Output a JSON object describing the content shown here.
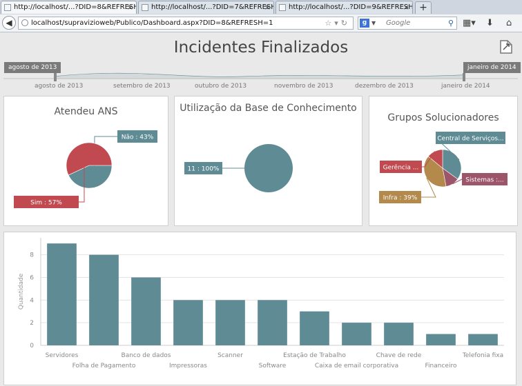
{
  "browser": {
    "tabs": [
      {
        "label": "http://localhost/...?DID=8&REFRESH=1",
        "active": true,
        "close": "×"
      },
      {
        "label": "http://localhost/...?DID=7&REFRESH=1",
        "active": false,
        "close": "×"
      },
      {
        "label": "http://localhost/...?DID=9&REFRESH=1",
        "active": false,
        "close": "×"
      }
    ],
    "new_tab": "+",
    "url": "localhost/supravizioweb/Publico/Dashboard.aspx?DID=8&REFRESH=1",
    "search_engine": "g",
    "search_placeholder": "Google"
  },
  "page": {
    "title": "Incidentes Finalizados",
    "range_start": "agosto de 2013",
    "range_end": "janeiro de 2014",
    "months": [
      "agosto de 2013",
      "setembro de 2013",
      "outubro de 2013",
      "novembro de 2013",
      "dezembro de 2013",
      "janeiro de 2014"
    ]
  },
  "colors": {
    "teal": "#5f8b95",
    "red": "#c14a50",
    "orange": "#b4894c",
    "plum": "#9c5569"
  },
  "chart_data": [
    {
      "type": "pie",
      "title": "Atendeu ANS",
      "labels": [
        "Não : 43%",
        "Sim : 57%"
      ],
      "categories": [
        "Não",
        "Sim"
      ],
      "values": [
        43,
        57
      ],
      "colors": [
        "#5f8b95",
        "#c14a50"
      ]
    },
    {
      "type": "pie",
      "title": "Utilização da Base de Conhecimento",
      "labels": [
        "11 : 100%"
      ],
      "categories": [
        "11"
      ],
      "values": [
        100
      ],
      "colors": [
        "#5f8b95"
      ]
    },
    {
      "type": "pie",
      "title": "Grupos Solucionadores",
      "labels": [
        "Central de Serviços...",
        "Sistemas :...",
        "Infra : 39%",
        "Gerência ..."
      ],
      "categories": [
        "Central de Serviços",
        "Sistemas",
        "Infra",
        "Gerência"
      ],
      "values": [
        35,
        12,
        39,
        14
      ],
      "colors": [
        "#5f8b95",
        "#9c5569",
        "#b4894c",
        "#c14a50"
      ]
    },
    {
      "type": "bar",
      "ylabel": "Quantidade",
      "ylim": [
        0,
        9.5
      ],
      "yticks": [
        0,
        2,
        4,
        6,
        8
      ],
      "categories": [
        "Servidores",
        "Folha de Pagamento",
        "Banco de dados",
        "Impressoras",
        "Scanner",
        "Software",
        "Estação de Trabalho",
        "Caixa de email corporativa",
        "Chave de rede",
        "Financeiro",
        "Telefonia fixa"
      ],
      "values": [
        9,
        8,
        6,
        4,
        4,
        4,
        3,
        2,
        2,
        1,
        1
      ],
      "color": "#5f8b95"
    }
  ]
}
